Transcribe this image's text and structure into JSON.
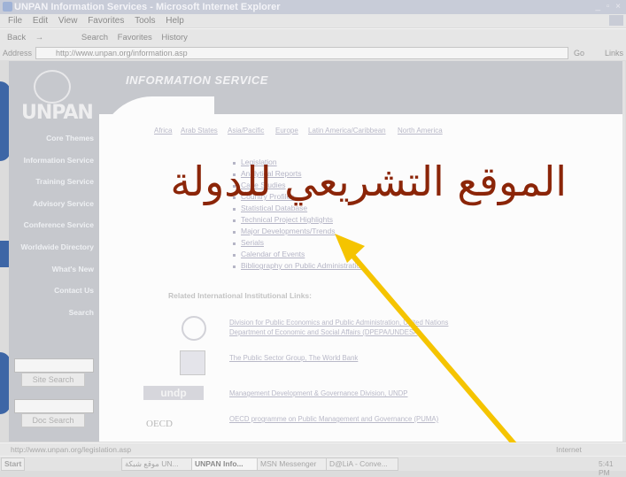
{
  "window": {
    "title": "UNPAN Information Services - Microsoft Internet Explorer",
    "controls": "_ ▫ ×"
  },
  "menu": [
    "File",
    "Edit",
    "View",
    "Favorites",
    "Tools",
    "Help"
  ],
  "toolbar": [
    "Back",
    "→",
    "Search",
    "Favorites",
    "History"
  ],
  "address": {
    "label": "Address",
    "url": "http://www.unpan.org/information.asp",
    "go": "Go",
    "links": "Links"
  },
  "page": {
    "logo": "UNPAN",
    "banner": "INFORMATION SERVICE",
    "nav": [
      "Core Themes",
      "Information Service",
      "Training Service",
      "Advisory Service",
      "Conference Service",
      "Worldwide Directory",
      "What's New",
      "Contact Us",
      "Search"
    ],
    "site_search_button": "Site Search",
    "doc_search_button": "Doc Search",
    "regions": [
      "Africa",
      "Arab States",
      "Asia/Pacific",
      "Europe",
      "Latin America/Caribbean",
      "North America"
    ],
    "links": [
      "Legislation",
      "Analytical Reports",
      "Case Studies",
      "Country Profiles",
      "Statistical Database",
      "Technical Project Highlights",
      "Major Developments/Trends",
      "Serials",
      "Calendar of Events",
      "Bibliography on Public Administration"
    ],
    "related_heading": "Related International Institutional Links:",
    "related": [
      {
        "text": "Division for Public Economics and Public Administration, United Nations Department of Economic and Social Affairs (DPEPA/UNDESA)",
        "logo": "un-emblem-icon"
      },
      {
        "text": "The Public Sector Group, The World Bank",
        "logo": "world-bank-icon"
      },
      {
        "text": "Management Development & Governance Division, UNDP",
        "logo": "undp-logo",
        "logo_text": "undp"
      },
      {
        "text": "OECD programme on Public Management and Governance (PUMA)",
        "logo": "oecd-logo",
        "logo_text": "OECD"
      }
    ]
  },
  "status": {
    "url": "http://www.unpan.org/legislation.asp",
    "zone": "Internet"
  },
  "taskbar": {
    "start": "Start",
    "items": [
      "موقع شبكة UN...",
      "UNPAN Info...",
      "MSN Messenger",
      "D@LiA - Conve..."
    ],
    "clock": "5:41 PM"
  },
  "overlay": {
    "arabic_text": "الموقع التشريعي للدولة",
    "text_color": "#8b2508",
    "arrow_color": "#f5c400"
  }
}
